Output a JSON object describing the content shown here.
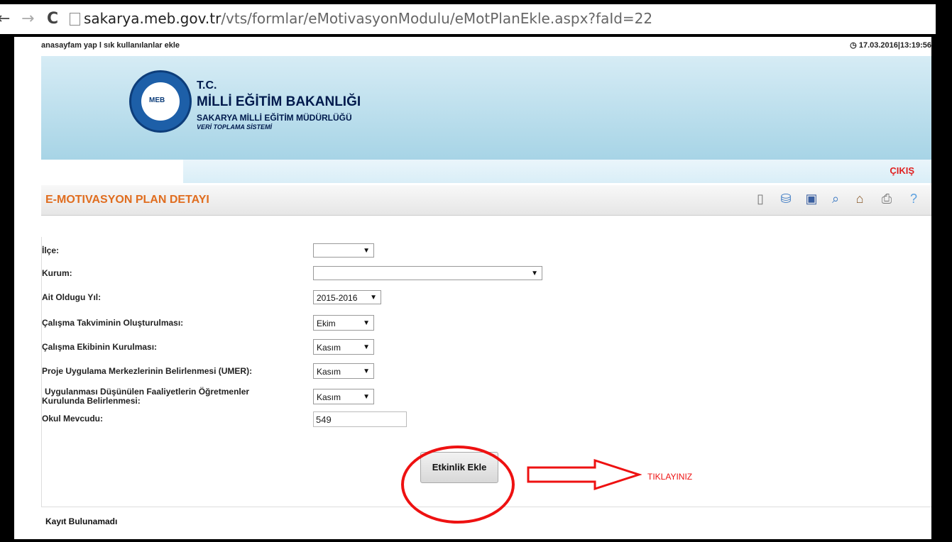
{
  "browser": {
    "back_icon": "back-arrow-icon",
    "forward_icon": "forward-arrow-icon",
    "reload_icon": "reload-icon",
    "url_host": "sakarya.meb.gov.tr",
    "url_path": "/vts/formlar/eMotivasyonModulu/eMotPlanEkle.aspx?faId=22"
  },
  "top": {
    "links": "anasayfam yap l sık kullanılanlar ekle",
    "datetime": "17.03.2016|13:19:56"
  },
  "header": {
    "logo_text": "MEB",
    "tc": "T.C.",
    "ministry": "MİLLİ EĞİTİM BAKANLIĞI",
    "directorate": "SAKARYA MİLLİ EĞİTİM MÜDÜRLÜĞÜ",
    "system": "VERİ TOPLAMA SİSTEMİ",
    "logout": "ÇIKIŞ"
  },
  "title": "E-MOTIVASYON PLAN DETAYI",
  "toolbar_icons": [
    "new-document-icon",
    "database-icon",
    "save-icon",
    "search-icon",
    "home-icon",
    "print-icon",
    "help-icon"
  ],
  "form": {
    "ilce": {
      "label": "İlçe:",
      "value": ""
    },
    "kurum": {
      "label": "Kurum:",
      "value": ""
    },
    "yil": {
      "label": "Ait Oldugu Yıl:",
      "value": "2015-2016"
    },
    "takvim": {
      "label": "Çalışma Takviminin Oluşturulması:",
      "value": "Ekim"
    },
    "ekip": {
      "label": "Çalışma Ekibinin Kurulması:",
      "value": "Kasım"
    },
    "umer": {
      "label": "Proje Uygulama Merkezlerinin Belirlenmesi (UMER):",
      "value": "Kasım"
    },
    "faaliyet": {
      "label_line1": "Uygulanması Düşünülen Faaliyetlerin Öğretmenler",
      "label_line2": "Kurulunda Belirlenmesi:",
      "value": "Kasım"
    },
    "mevcut": {
      "label": "Okul Mevcudu:",
      "value": "549"
    }
  },
  "add_button": "Etkinlik Ekle",
  "annotation": "TIKLAYINIZ",
  "no_record": "Kayıt Bulunamadı"
}
